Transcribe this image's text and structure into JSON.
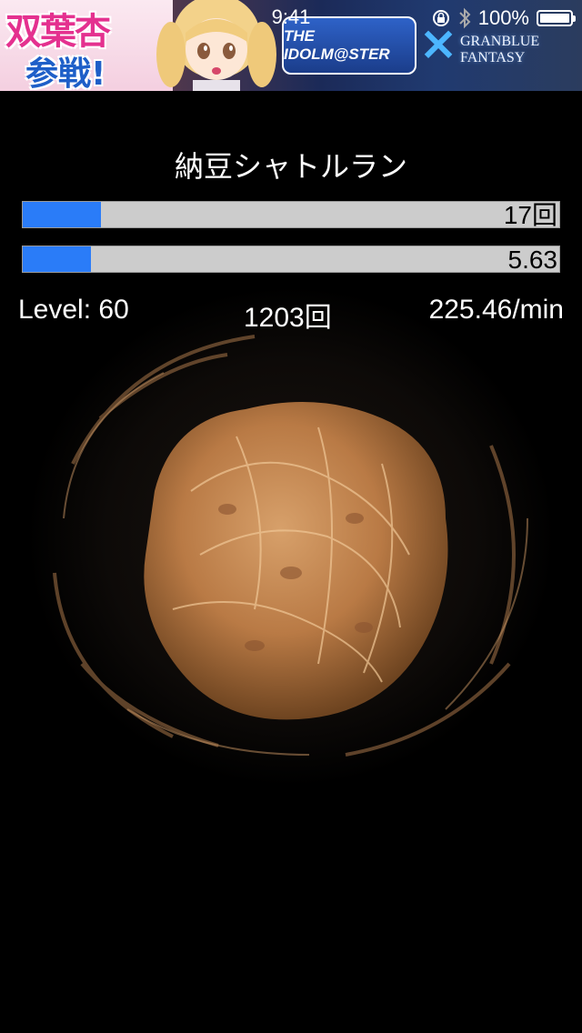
{
  "ad": {
    "title_line1": "双葉杏",
    "title_line2": "参戦!",
    "logo_left": "THE IDOLM@STER",
    "cross": "×",
    "logo_right": "GRANBLUE FANTASY"
  },
  "status_bar": {
    "time": "9:41",
    "battery_text": "100%",
    "battery_level": 1.0
  },
  "main": {
    "title": "納豆シャトルラン",
    "bar1": {
      "text": "17回",
      "fill": 0.145
    },
    "bar2": {
      "text": "5.63",
      "fill": 0.127
    },
    "stats": {
      "level": "Level: 60",
      "count": "1203回",
      "rate": "225.46/min"
    }
  },
  "colors": {
    "background": "#000000",
    "progress_fill": "#2a7cf8",
    "progress_track": "#cccccc",
    "natto": "#b97a45"
  },
  "icons": {
    "lock": "rotation-lock-icon",
    "bluetooth": "bluetooth-icon",
    "battery": "battery-icon"
  }
}
